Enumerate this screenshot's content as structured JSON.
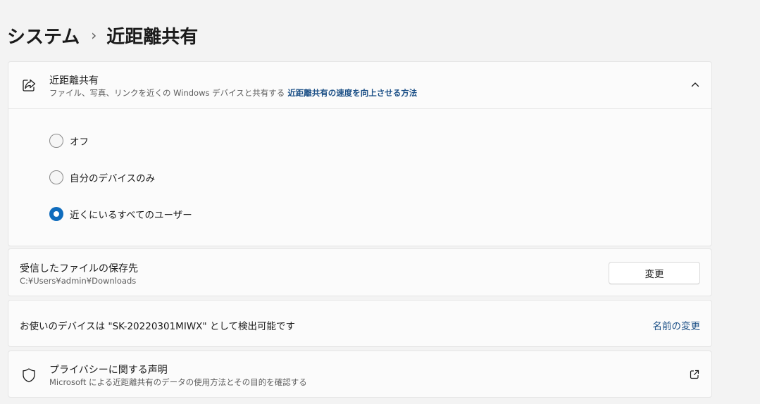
{
  "breadcrumb": {
    "parent": "システム",
    "separator": "›",
    "current": "近距離共有"
  },
  "nearby_sharing": {
    "title": "近距離共有",
    "subtitle": "ファイル、写真、リンクを近くの Windows デバイスと共有する",
    "link": "近距離共有の速度を向上させる方法",
    "expanded": true,
    "options": [
      {
        "label": "オフ",
        "checked": false
      },
      {
        "label": "自分のデバイスのみ",
        "checked": false
      },
      {
        "label": "近くにいるすべてのユーザー",
        "checked": true
      }
    ]
  },
  "save_location": {
    "title": "受信したファイルの保存先",
    "path": "C:¥Users¥admin¥Downloads",
    "button": "変更"
  },
  "discoverable": {
    "text": "お使いのデバイスは \"SK-20220301MIWX\" として検出可能です",
    "link": "名前の変更"
  },
  "privacy": {
    "title": "プライバシーに関する声明",
    "subtitle": "Microsoft による近距離共有のデータの使用方法とその目的を確認する"
  },
  "colors": {
    "accent": "#0f6cbd",
    "link": "#1b4f86",
    "background": "#f3f3f3",
    "card": "#fbfbfb"
  }
}
